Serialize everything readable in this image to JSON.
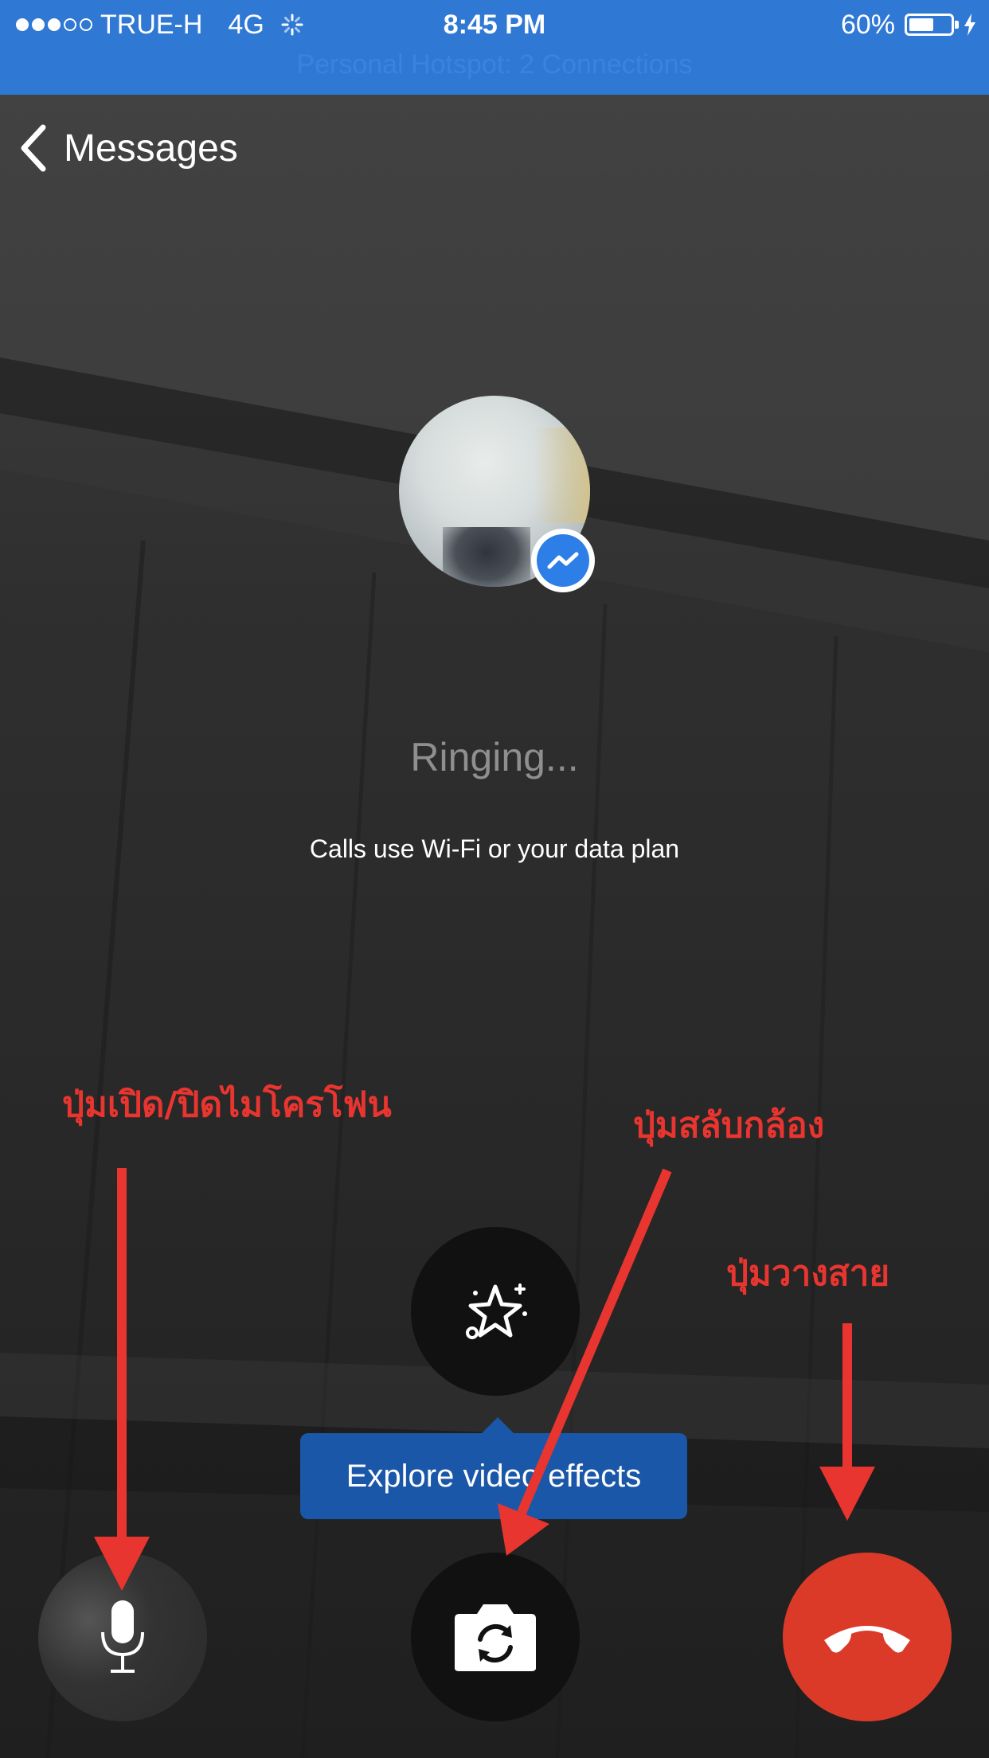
{
  "status_bar": {
    "carrier": "TRUE-H",
    "network": "4G",
    "time": "8:45 PM",
    "battery_text": "60%",
    "battery_level": 0.6,
    "hotspot_text": "Personal Hotspot: 2 Connections",
    "signal_bars_filled": 3,
    "signal_bars_total": 5
  },
  "nav": {
    "back_label": "Messages"
  },
  "call": {
    "status": "Ringing...",
    "info": "Calls use Wi-Fi or your data plan"
  },
  "tooltip": {
    "text": "Explore video effects"
  },
  "annotations": {
    "mic_label": "ปุ่มเปิด/ปิดไมโครโฟน",
    "flip_label": "ปุ่มสลับกล้อง",
    "end_label": "ปุ่มวางสาย"
  },
  "colors": {
    "status_bar": "#2f78d4",
    "end_call": "#dc3a29",
    "tooltip": "#1a57a8",
    "annotation": "#e8352f",
    "messenger_badge": "#2d7ee6"
  },
  "icons": {
    "back": "chevron-left-icon",
    "effects": "sparkle-star-icon",
    "flip": "camera-flip-icon",
    "mic": "microphone-icon",
    "end": "phone-hangup-icon",
    "badge": "messenger-icon"
  }
}
